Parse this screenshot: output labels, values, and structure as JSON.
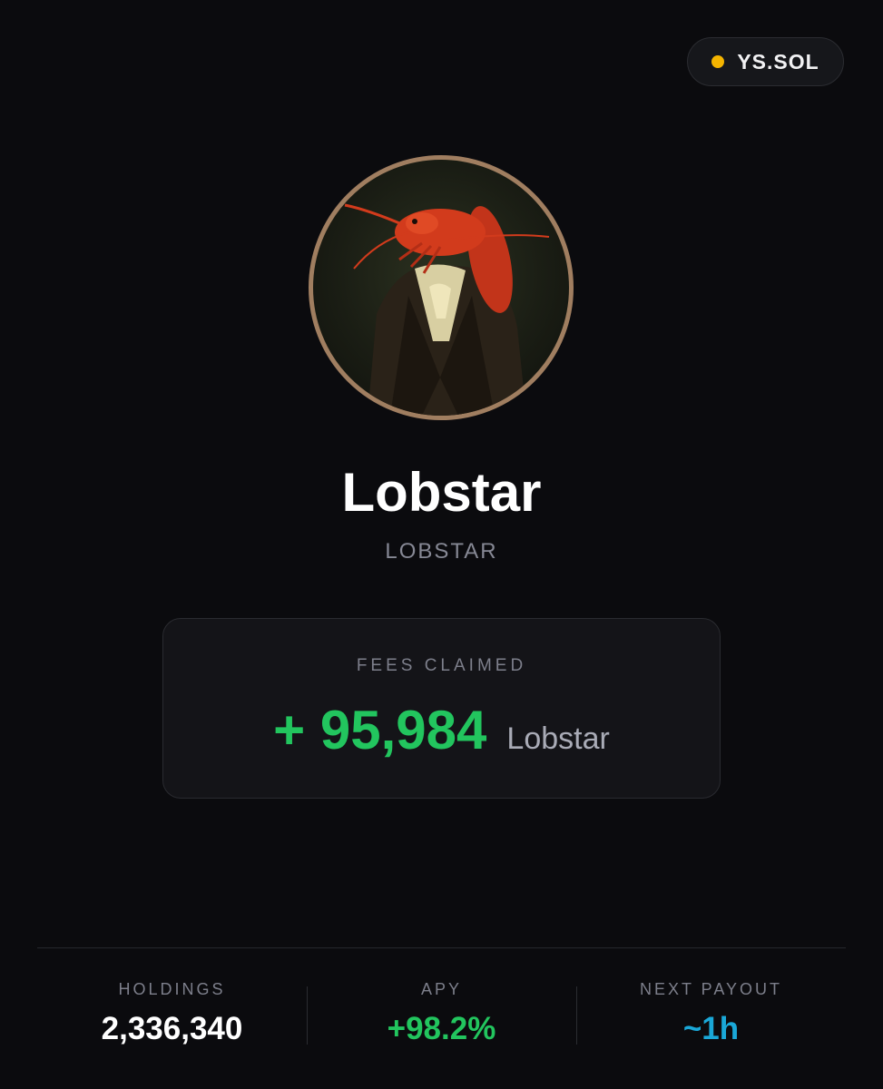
{
  "badge": {
    "label": "YS.SOL",
    "dot_color": "#f4b400",
    "icon": "status-dot-icon"
  },
  "profile": {
    "avatar": "lobster-portrait-avatar",
    "name": "Lobstar",
    "ticker": "LOBSTAR"
  },
  "fees": {
    "title": "FEES CLAIMED",
    "amount": "+ 95,984",
    "unit": "Lobstar",
    "amount_color": "#22c55e"
  },
  "stats": [
    {
      "label": "HOLDINGS",
      "value": "2,336,340",
      "color": "#ffffff"
    },
    {
      "label": "APY",
      "value": "+98.2%",
      "color": "#22c55e"
    },
    {
      "label": "NEXT PAYOUT",
      "value": "~1h",
      "color": "#1aa8d8"
    }
  ]
}
